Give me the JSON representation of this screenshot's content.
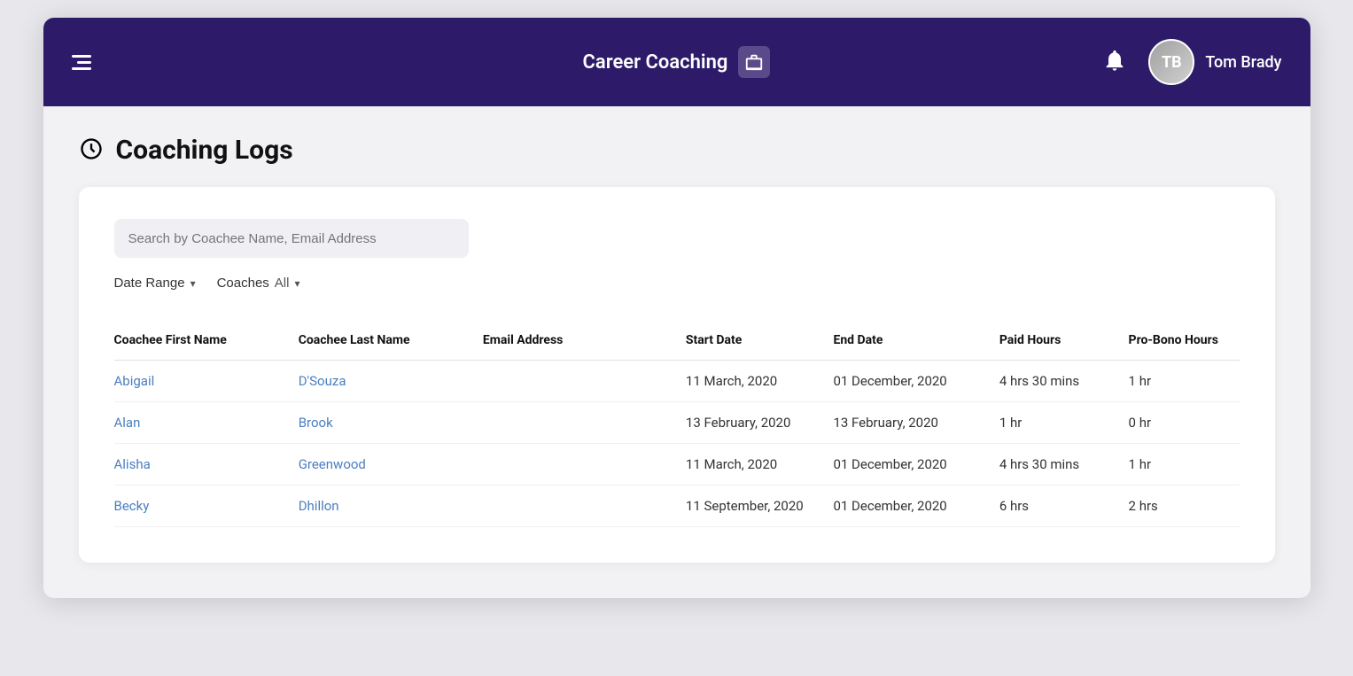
{
  "header": {
    "title": "Career Coaching",
    "user_name": "Tom Brady",
    "bell_label": "notifications"
  },
  "page": {
    "title": "Coaching Logs"
  },
  "search": {
    "placeholder": "Search by Coachee Name, Email Address"
  },
  "filters": {
    "date_range_label": "Date Range",
    "coaches_label": "Coaches",
    "coaches_value": "All"
  },
  "table": {
    "headers": [
      "Coachee First Name",
      "Coachee Last Name",
      "Email Address",
      "Start Date",
      "End Date",
      "Paid Hours",
      "Pro-Bono Hours"
    ],
    "rows": [
      {
        "first_name": "Abigail",
        "last_name": "D'Souza",
        "email": "",
        "start_date": "11 March, 2020",
        "end_date": "01 December, 2020",
        "paid_hours": "4 hrs 30 mins",
        "probono_hours": "1 hr"
      },
      {
        "first_name": "Alan",
        "last_name": "Brook",
        "email": "",
        "start_date": "13 February, 2020",
        "end_date": "13 February, 2020",
        "paid_hours": "1 hr",
        "probono_hours": "0 hr"
      },
      {
        "first_name": "Alisha",
        "last_name": "Greenwood",
        "email": "",
        "start_date": "11 March, 2020",
        "end_date": "01 December, 2020",
        "paid_hours": "4 hrs 30 mins",
        "probono_hours": "1 hr"
      },
      {
        "first_name": "Becky",
        "last_name": "Dhillon",
        "email": "",
        "start_date": "11 September, 2020",
        "end_date": "01 December, 2020",
        "paid_hours": "6 hrs",
        "probono_hours": "2 hrs"
      }
    ]
  }
}
